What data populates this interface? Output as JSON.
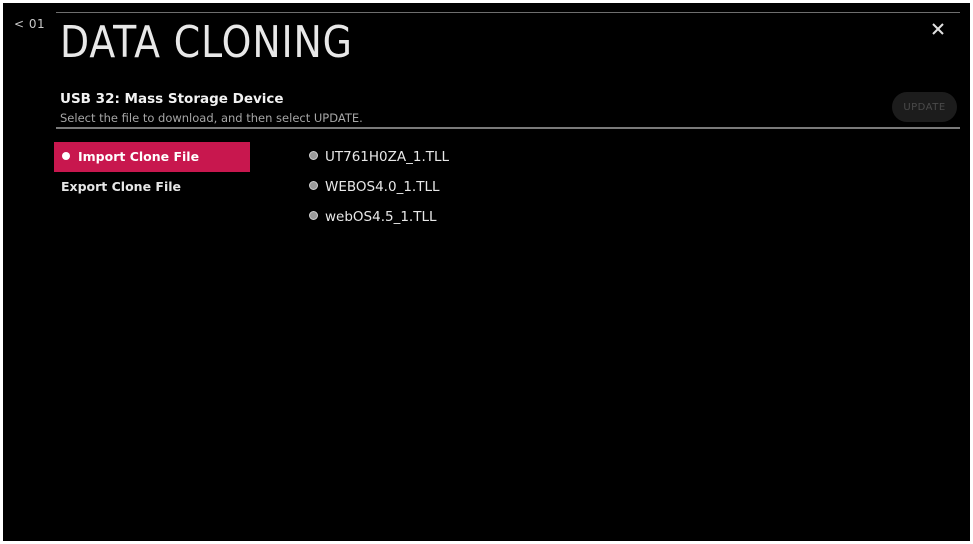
{
  "nav": {
    "back_label": "< 01"
  },
  "header": {
    "title": "DATA CLONING",
    "device": "USB 32: Mass Storage Device",
    "instruction": "Select the file to download, and then select UPDATE.",
    "update_label": "UPDATE",
    "close_icon": "close-icon"
  },
  "menu": {
    "items": [
      {
        "label": "Import Clone File",
        "selected": true
      },
      {
        "label": "Export Clone File",
        "selected": false
      }
    ]
  },
  "files": {
    "items": [
      {
        "name": "UT761H0ZA_1.TLL"
      },
      {
        "name": "WEBOS4.0_1.TLL"
      },
      {
        "name": "webOS4.5_1.TLL"
      }
    ]
  },
  "colors": {
    "background": "#000000",
    "accent": "#c8174e",
    "text": "#ffffff",
    "muted_text": "#a6a6a6",
    "disabled_button": "#1c1c1c"
  }
}
